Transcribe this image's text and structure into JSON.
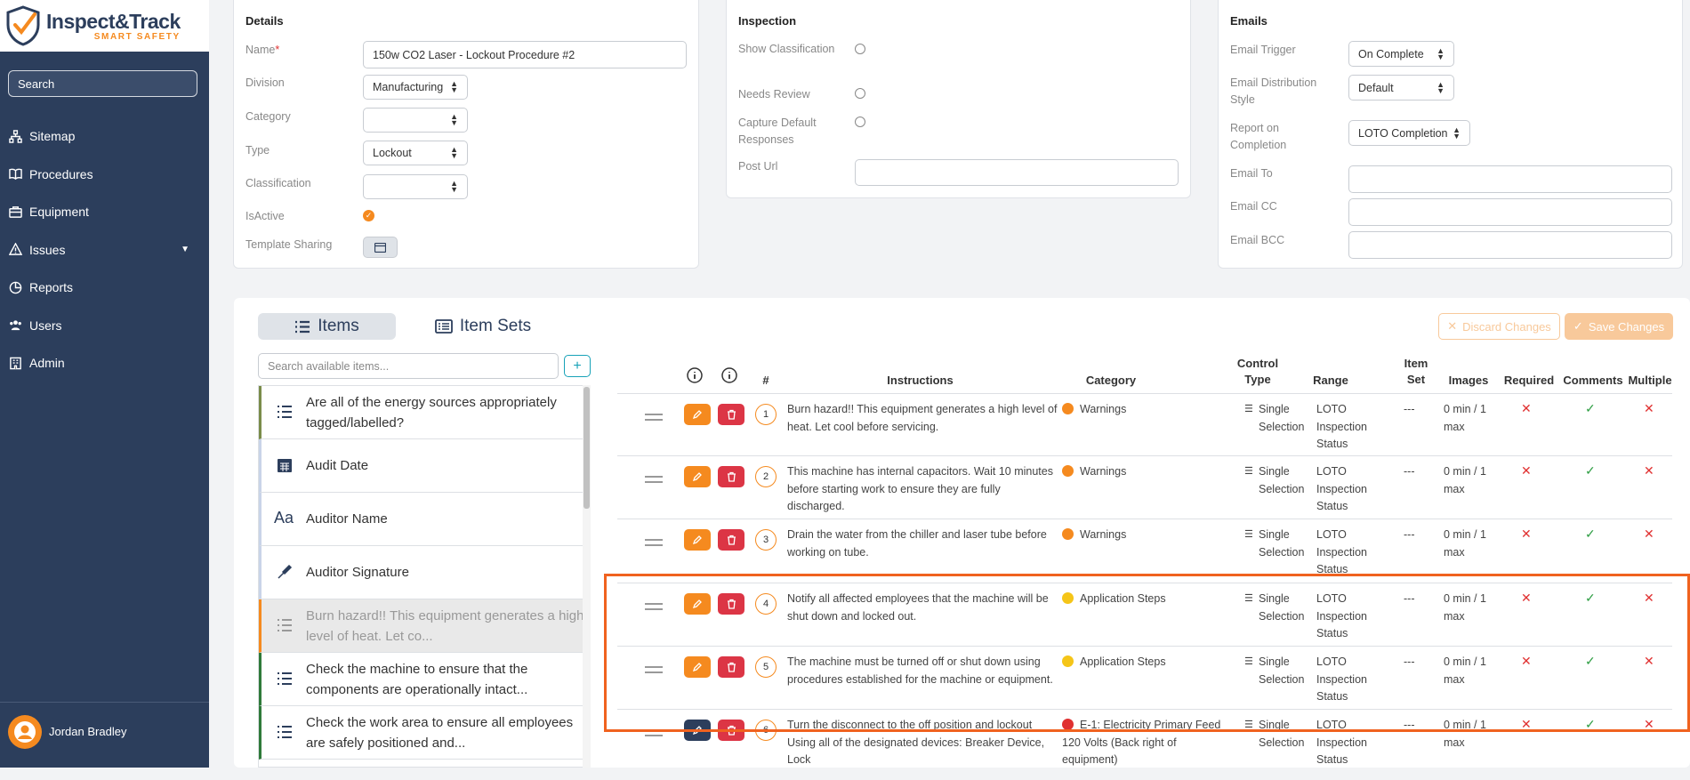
{
  "brand": {
    "name": "Inspect&Track",
    "tagline": "SMART SAFETY"
  },
  "sidebar": {
    "search_placeholder": "Search",
    "items": [
      {
        "label": "Sitemap",
        "icon": "sitemap-icon"
      },
      {
        "label": "Procedures",
        "icon": "book-icon"
      },
      {
        "label": "Equipment",
        "icon": "briefcase-icon"
      },
      {
        "label": "Issues",
        "icon": "warning-icon"
      },
      {
        "label": "Reports",
        "icon": "chart-pie-icon"
      },
      {
        "label": "Users",
        "icon": "users-icon"
      },
      {
        "label": "Admin",
        "icon": "building-icon"
      }
    ],
    "user": "Jordan Bradley"
  },
  "details": {
    "title": "Details",
    "name_label": "Name",
    "name_required": "*",
    "name_value": "150w CO2 Laser - Lockout Procedure #2",
    "division_label": "Division",
    "division_value": "Manufacturing",
    "category_label": "Category",
    "category_value": "",
    "type_label": "Type",
    "type_value": "Lockout",
    "classification_label": "Classification",
    "classification_value": "",
    "isactive_label": "IsActive",
    "template_sharing_label": "Template Sharing"
  },
  "inspection": {
    "title": "Inspection",
    "show_classification": "Show Classification",
    "needs_review": "Needs Review",
    "capture_default": "Capture Default Responses",
    "post_url": "Post Url"
  },
  "emails": {
    "title": "Emails",
    "trigger_label": "Email Trigger",
    "trigger_value": "On Complete",
    "dist_label": "Email Distribution Style",
    "dist_value": "Default",
    "report_label": "Report on Completion",
    "report_value": "LOTO Completion",
    "to_label": "Email To",
    "cc_label": "Email CC",
    "bcc_label": "Email BCC"
  },
  "tabs": {
    "items": "Items",
    "item_sets": "Item Sets"
  },
  "actions": {
    "discard": "Discard Changes",
    "save": "Save Changes"
  },
  "available": {
    "search_placeholder": "Search available items...",
    "items": [
      {
        "label": "Are all of the energy sources appropriately tagged/labelled?",
        "icon": "list-icon"
      },
      {
        "label": "Audit Date",
        "icon": "calendar-icon"
      },
      {
        "label": "Auditor Name",
        "icon": "text-icon"
      },
      {
        "label": "Auditor Signature",
        "icon": "signature-icon"
      },
      {
        "label": "Burn hazard!! This equipment generates a high level of heat. Let co...",
        "icon": "list-icon"
      },
      {
        "label": "Check the machine to ensure that the components are operationally intact...",
        "icon": "list-icon"
      },
      {
        "label": "Check the work area to ensure all employees are safely positioned and...",
        "icon": "list-icon"
      }
    ]
  },
  "table": {
    "headers": {
      "num": "#",
      "instructions": "Instructions",
      "category": "Category",
      "control_type_1": "Control",
      "control_type_2": "Type",
      "range": "Range",
      "item_set_1": "Item",
      "item_set_2": "Set",
      "images": "Images",
      "required": "Required",
      "comments": "Comments",
      "multiple": "Multiple"
    },
    "rows": [
      {
        "n": "1",
        "instructions": "Burn hazard!! This equipment generates a high level of heat. Let cool before servicing.",
        "category": "Warnings",
        "cat_color": "#f58a1f",
        "control": "Single Selection",
        "range": "LOTO Inspection Status",
        "item_set": "---",
        "images": "0 min / 1 max"
      },
      {
        "n": "2",
        "instructions": "This machine has internal capacitors. Wait 10 minutes before starting work to ensure they are fully discharged.",
        "category": "Warnings",
        "cat_color": "#f58a1f",
        "control": "Single Selection",
        "range": "LOTO Inspection Status",
        "item_set": "---",
        "images": "0 min / 1 max"
      },
      {
        "n": "3",
        "instructions": "Drain the water from the chiller and laser tube before working on tube.",
        "category": "Warnings",
        "cat_color": "#f58a1f",
        "control": "Single Selection",
        "range": "LOTO Inspection Status",
        "item_set": "---",
        "images": "0 min / 1 max"
      },
      {
        "n": "4",
        "instructions": "Notify all affected employees that the machine will be shut down and locked out.",
        "category": "Application Steps",
        "cat_color": "#f5c518",
        "control": "Single Selection",
        "range": "LOTO Inspection Status",
        "item_set": "---",
        "images": "0 min / 1 max"
      },
      {
        "n": "5",
        "instructions": "The machine must be turned off or shut down using procedures established for the machine or equipment.",
        "category": "Application Steps",
        "cat_color": "#f5c518",
        "control": "Single Selection",
        "range": "LOTO Inspection Status",
        "item_set": "---",
        "images": "0 min / 1 max"
      },
      {
        "n": "6",
        "instructions": "Turn the disconnect to the off position and lockout Using all of the designated devices: Breaker Device, Lock",
        "category": "E-1: Electricity Primary Feed 120 Volts (Back right of equipment)",
        "cat_color": "#e03131",
        "control": "Single Selection",
        "range": "LOTO Inspection Status",
        "item_set": "---",
        "images": "0 min / 1 max"
      }
    ]
  },
  "colors": {
    "sidebar": "#2c3e5c",
    "accent": "#f58a1f",
    "danger": "#dc3545",
    "highlight": "#f0621f"
  }
}
